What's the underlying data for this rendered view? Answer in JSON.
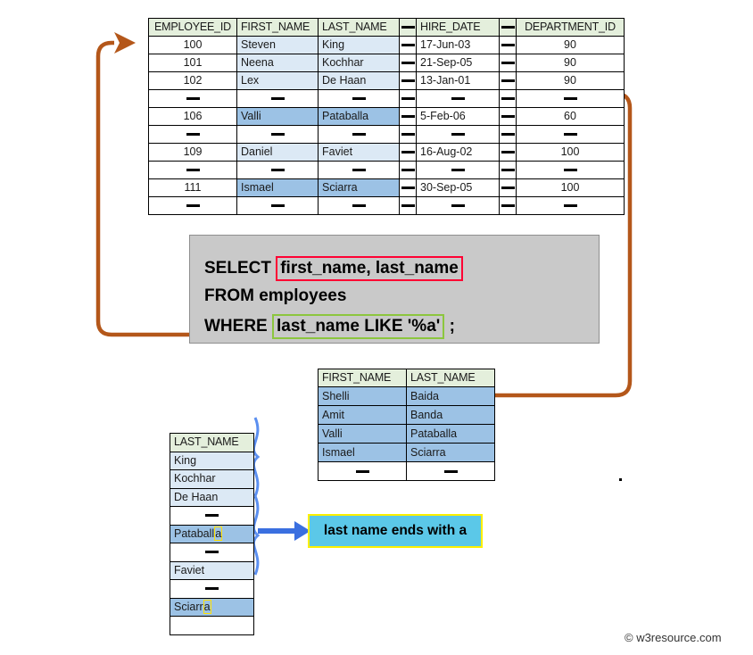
{
  "employees_table": {
    "name": "employees-table",
    "headers": [
      "EMPLOYEE_ID",
      "FIRST_NAME",
      "LAST_NAME",
      "—",
      "HIRE_DATE",
      "—",
      "DEPARTMENT_ID"
    ],
    "rows": [
      {
        "employee_id": "100",
        "first_name": "Steven",
        "last_name": "King",
        "sep1": "—",
        "hire_date": "17-Jun-03",
        "sep2": "—",
        "department_id": "90",
        "style": "light"
      },
      {
        "employee_id": "101",
        "first_name": "Neena",
        "last_name": "Kochhar",
        "sep1": "—",
        "hire_date": "21-Sep-05",
        "sep2": "—",
        "department_id": "90",
        "style": "light"
      },
      {
        "employee_id": "102",
        "first_name": "Lex",
        "last_name": "De Haan",
        "sep1": "—",
        "hire_date": "13-Jan-01",
        "sep2": "—",
        "department_id": "90",
        "style": "light"
      },
      {
        "employee_id": "—",
        "first_name": "—",
        "last_name": "—",
        "sep1": "—",
        "hire_date": "—",
        "sep2": "—",
        "department_id": "—",
        "style": "dash"
      },
      {
        "employee_id": "106",
        "first_name": "Valli",
        "last_name": "Pataballa",
        "sep1": "—",
        "hire_date": "5-Feb-06",
        "sep2": "—",
        "department_id": "60",
        "style": "mid"
      },
      {
        "employee_id": "—",
        "first_name": "—",
        "last_name": "—",
        "sep1": "—",
        "hire_date": "—",
        "sep2": "—",
        "department_id": "—",
        "style": "dash"
      },
      {
        "employee_id": "109",
        "first_name": "Daniel",
        "last_name": "Faviet",
        "sep1": "—",
        "hire_date": "16-Aug-02",
        "sep2": "—",
        "department_id": "100",
        "style": "light"
      },
      {
        "employee_id": "—",
        "first_name": "—",
        "last_name": "—",
        "sep1": "—",
        "hire_date": "—",
        "sep2": "—",
        "department_id": "—",
        "style": "dash"
      },
      {
        "employee_id": "111",
        "first_name": "Ismael",
        "last_name": "Sciarra",
        "sep1": "—",
        "hire_date": "30-Sep-05",
        "sep2": "—",
        "department_id": "100",
        "style": "mid"
      },
      {
        "employee_id": "—",
        "first_name": "—",
        "last_name": "—",
        "sep1": "—",
        "hire_date": "—",
        "sep2": "—",
        "department_id": "—",
        "style": "dash"
      }
    ]
  },
  "sql": {
    "keyword_select": "SELECT",
    "select_list": "first_name, last_name",
    "keyword_from_clause": "FROM employees",
    "keyword_where": "WHERE",
    "where_condition": "last_name LIKE '%a'",
    "semicolon": ";"
  },
  "result_table": {
    "headers": [
      "FIRST_NAME",
      "LAST_NAME"
    ],
    "rows": [
      {
        "first_name": "Shelli",
        "last_name": "Baida",
        "style": "mid"
      },
      {
        "first_name": "Amit",
        "last_name": "Banda",
        "style": "mid"
      },
      {
        "first_name": "Valli",
        "last_name": "Pataballa",
        "style": "mid"
      },
      {
        "first_name": "Ismael",
        "last_name": "Sciarra",
        "style": "mid"
      },
      {
        "first_name": "—",
        "last_name": "—",
        "style": "dash"
      }
    ]
  },
  "lastname_table": {
    "header": "LAST_NAME",
    "rows": [
      {
        "value": "King",
        "style": "light",
        "highlight_tail": ""
      },
      {
        "value": "Kochhar",
        "style": "light",
        "highlight_tail": ""
      },
      {
        "value": "De Haan",
        "style": "light",
        "highlight_tail": ""
      },
      {
        "value": "—",
        "style": "dash",
        "highlight_tail": ""
      },
      {
        "value": "Pataball",
        "style": "mid",
        "highlight_tail": "a"
      },
      {
        "value": "—",
        "style": "dash",
        "highlight_tail": ""
      },
      {
        "value": "Faviet",
        "style": "light",
        "highlight_tail": ""
      },
      {
        "value": "—",
        "style": "dash",
        "highlight_tail": ""
      },
      {
        "value": "Sciarr",
        "style": "mid",
        "highlight_tail": "a"
      },
      {
        "value": "",
        "style": "white",
        "highlight_tail": ""
      }
    ]
  },
  "callout": {
    "text": "last name ends with a"
  },
  "watermark": {
    "text": "©  w3resource.com"
  },
  "colors": {
    "header_green": "#E4EFDC",
    "row_light_blue": "#DCE9F5",
    "row_mid_blue": "#9CC2E5",
    "sql_panel_gray": "#C9C9C9",
    "highlight_red": "#FF0033",
    "highlight_green": "#8CC63E",
    "callout_fill": "#5BC8E8",
    "callout_border": "#FFF000",
    "arrow_brown": "#B4571A",
    "brace_blue": "#5B8FF0",
    "mark_yellow": "#FFE000"
  }
}
